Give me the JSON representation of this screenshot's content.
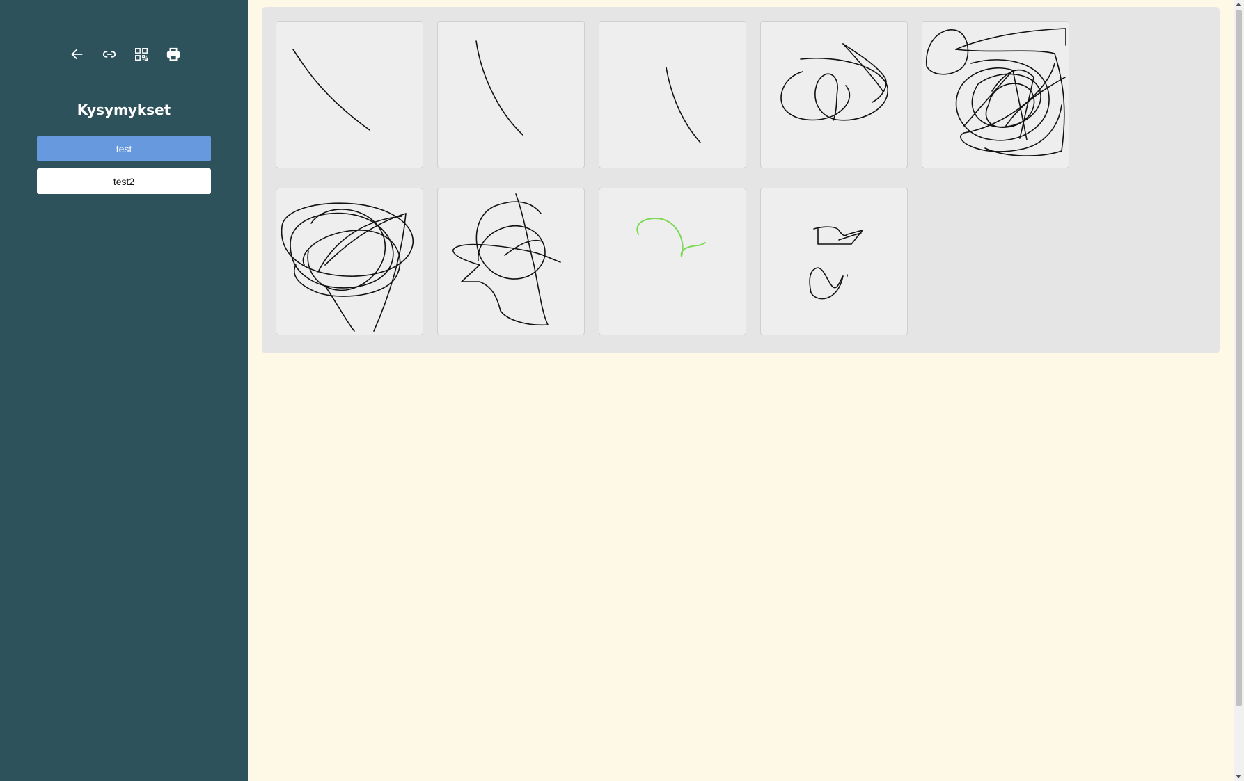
{
  "sidebar": {
    "tools": [
      {
        "icon": "arrow-left-icon"
      },
      {
        "icon": "link-icon"
      },
      {
        "icon": "qr-code-icon"
      },
      {
        "icon": "printer-icon"
      }
    ],
    "title": "Kysymykset",
    "questions": [
      {
        "label": "test",
        "active": true
      },
      {
        "label": "test2",
        "active": false
      }
    ]
  },
  "colors": {
    "sidebar_bg": "#2e525c",
    "page_bg": "#fef8e6",
    "active_question": "#6799de",
    "panel_bg": "#e5e5e5",
    "green_stroke": "#7ed957"
  },
  "drawings": {
    "count": 9
  }
}
